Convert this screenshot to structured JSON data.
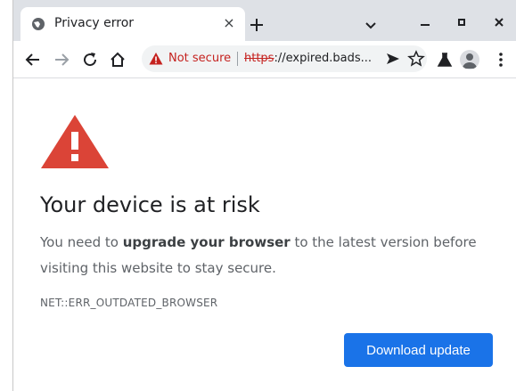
{
  "tab": {
    "title": "Privacy error",
    "close": "×"
  },
  "omnibox": {
    "security_label": "Not secure",
    "url_scheme": "https",
    "url_rest": "://expired.bads..."
  },
  "page": {
    "heading": "Your device is at risk",
    "para_before": "You need to ",
    "para_bold": "upgrade your browser",
    "para_after": " to the latest version before visiting this website to stay secure.",
    "error_code": "NET::ERR_OUTDATED_BROWSER",
    "button_label": "Download update"
  },
  "colors": {
    "warning_red": "#db4437",
    "button_blue": "#1a73e8",
    "not_secure_red": "#c5221f"
  }
}
